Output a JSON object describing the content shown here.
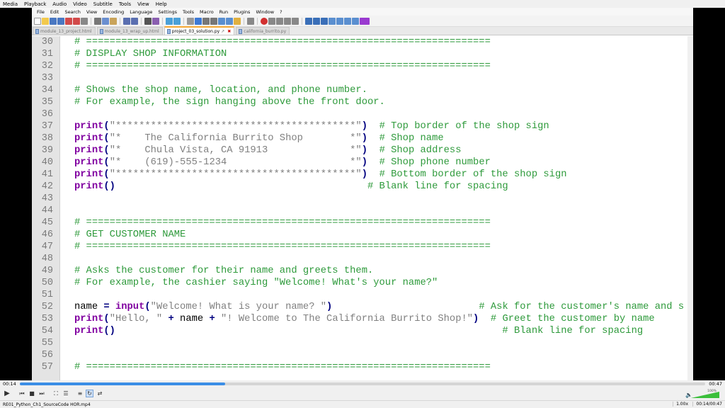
{
  "player": {
    "menu": [
      "Media",
      "Playback",
      "Audio",
      "Video",
      "Subtitle",
      "Tools",
      "View",
      "Help"
    ],
    "time_elapsed": "00:14",
    "time_total": "00:47",
    "progress_fraction": 0.3,
    "volume_label": "100%",
    "volume_fraction": 1.0,
    "filename": "RE01_Python_Ch1_SourceCode HOR.mp4",
    "speed": "1.00x",
    "status_time": "00:14/00:47"
  },
  "editor_app": {
    "menu": [
      "File",
      "Edit",
      "Search",
      "View",
      "Encoding",
      "Language",
      "Settings",
      "Tools",
      "Macro",
      "Run",
      "Plugins",
      "Window",
      "?"
    ],
    "tabs": [
      {
        "label": "module_13_project.html",
        "active": false
      },
      {
        "label": "module_13_wrap_up.html",
        "active": false
      },
      {
        "label": "project_03_solution.py",
        "active": true
      },
      {
        "label": "california_burrito.py",
        "active": false
      }
    ]
  },
  "code_lines": [
    {
      "num": "30",
      "tokens": [
        {
          "c": "cmt",
          "t": "# ====================================================================="
        }
      ]
    },
    {
      "num": "31",
      "tokens": [
        {
          "c": "cmt",
          "t": "# DISPLAY SHOP INFORMATION"
        }
      ]
    },
    {
      "num": "32",
      "tokens": [
        {
          "c": "cmt",
          "t": "# ====================================================================="
        }
      ]
    },
    {
      "num": "33",
      "tokens": []
    },
    {
      "num": "34",
      "tokens": [
        {
          "c": "cmt",
          "t": "# Shows the shop name, location, and phone number."
        }
      ]
    },
    {
      "num": "35",
      "tokens": [
        {
          "c": "cmt",
          "t": "# For example, the sign hanging above the front door."
        }
      ]
    },
    {
      "num": "36",
      "tokens": []
    },
    {
      "num": "37",
      "tokens": [
        {
          "c": "kw",
          "t": "print"
        },
        {
          "c": "pn",
          "t": "("
        },
        {
          "c": "str",
          "t": "\"*****************************************\""
        },
        {
          "c": "pn",
          "t": ")"
        },
        {
          "c": "id",
          "t": "  "
        },
        {
          "c": "cmt",
          "t": "# Top border of the shop sign"
        }
      ]
    },
    {
      "num": "38",
      "tokens": [
        {
          "c": "kw",
          "t": "print"
        },
        {
          "c": "pn",
          "t": "("
        },
        {
          "c": "str",
          "t": "\"*    The California Burrito Shop        *\""
        },
        {
          "c": "pn",
          "t": ")"
        },
        {
          "c": "id",
          "t": "  "
        },
        {
          "c": "cmt",
          "t": "# Shop name"
        }
      ]
    },
    {
      "num": "39",
      "tokens": [
        {
          "c": "kw",
          "t": "print"
        },
        {
          "c": "pn",
          "t": "("
        },
        {
          "c": "str",
          "t": "\"*    Chula Vista, CA 91913              *\""
        },
        {
          "c": "pn",
          "t": ")"
        },
        {
          "c": "id",
          "t": "  "
        },
        {
          "c": "cmt",
          "t": "# Shop address"
        }
      ]
    },
    {
      "num": "40",
      "tokens": [
        {
          "c": "kw",
          "t": "print"
        },
        {
          "c": "pn",
          "t": "("
        },
        {
          "c": "str",
          "t": "\"*    (619)-555-1234                     *\""
        },
        {
          "c": "pn",
          "t": ")"
        },
        {
          "c": "id",
          "t": "  "
        },
        {
          "c": "cmt",
          "t": "# Shop phone number"
        }
      ]
    },
    {
      "num": "41",
      "tokens": [
        {
          "c": "kw",
          "t": "print"
        },
        {
          "c": "pn",
          "t": "("
        },
        {
          "c": "str",
          "t": "\"*****************************************\""
        },
        {
          "c": "pn",
          "t": ")"
        },
        {
          "c": "id",
          "t": "  "
        },
        {
          "c": "cmt",
          "t": "# Bottom border of the shop sign"
        }
      ]
    },
    {
      "num": "42",
      "tokens": [
        {
          "c": "kw",
          "t": "print"
        },
        {
          "c": "pn",
          "t": "()"
        },
        {
          "c": "id",
          "t": "                                           "
        },
        {
          "c": "cmt",
          "t": "# Blank line for spacing"
        }
      ]
    },
    {
      "num": "43",
      "tokens": []
    },
    {
      "num": "44",
      "tokens": []
    },
    {
      "num": "45",
      "tokens": [
        {
          "c": "cmt",
          "t": "# ====================================================================="
        }
      ]
    },
    {
      "num": "46",
      "tokens": [
        {
          "c": "cmt",
          "t": "# GET CUSTOMER NAME"
        }
      ]
    },
    {
      "num": "47",
      "tokens": [
        {
          "c": "cmt",
          "t": "# ====================================================================="
        }
      ]
    },
    {
      "num": "48",
      "tokens": []
    },
    {
      "num": "49",
      "tokens": [
        {
          "c": "cmt",
          "t": "# Asks the customer for their name and greets them."
        }
      ]
    },
    {
      "num": "50",
      "tokens": [
        {
          "c": "cmt",
          "t": "# For example, the cashier saying \"Welcome! What's your name?\""
        }
      ]
    },
    {
      "num": "51",
      "tokens": []
    },
    {
      "num": "52",
      "tokens": [
        {
          "c": "id",
          "t": "name "
        },
        {
          "c": "op",
          "t": "="
        },
        {
          "c": "id",
          "t": " "
        },
        {
          "c": "kw",
          "t": "input"
        },
        {
          "c": "pn",
          "t": "("
        },
        {
          "c": "str",
          "t": "\"Welcome! What is your name? \""
        },
        {
          "c": "pn",
          "t": ")"
        },
        {
          "c": "id",
          "t": "                         "
        },
        {
          "c": "cmt",
          "t": "# Ask for the customer's name and s"
        }
      ]
    },
    {
      "num": "53",
      "tokens": [
        {
          "c": "kw",
          "t": "print"
        },
        {
          "c": "pn",
          "t": "("
        },
        {
          "c": "str",
          "t": "\"Hello, \""
        },
        {
          "c": "id",
          "t": " "
        },
        {
          "c": "op",
          "t": "+"
        },
        {
          "c": "id",
          "t": " name "
        },
        {
          "c": "op",
          "t": "+"
        },
        {
          "c": "id",
          "t": " "
        },
        {
          "c": "str",
          "t": "\"! Welcome to The California Burrito Shop!\""
        },
        {
          "c": "pn",
          "t": ")"
        },
        {
          "c": "id",
          "t": "  "
        },
        {
          "c": "cmt",
          "t": "# Greet the customer by name"
        }
      ]
    },
    {
      "num": "54",
      "tokens": [
        {
          "c": "kw",
          "t": "print"
        },
        {
          "c": "pn",
          "t": "()"
        },
        {
          "c": "id",
          "t": "                                                                  "
        },
        {
          "c": "cmt",
          "t": "# Blank line for spacing"
        }
      ]
    },
    {
      "num": "55",
      "tokens": []
    },
    {
      "num": "56",
      "tokens": []
    },
    {
      "num": "57",
      "tokens": [
        {
          "c": "cmt",
          "t": "# ====================================================================="
        }
      ]
    }
  ]
}
